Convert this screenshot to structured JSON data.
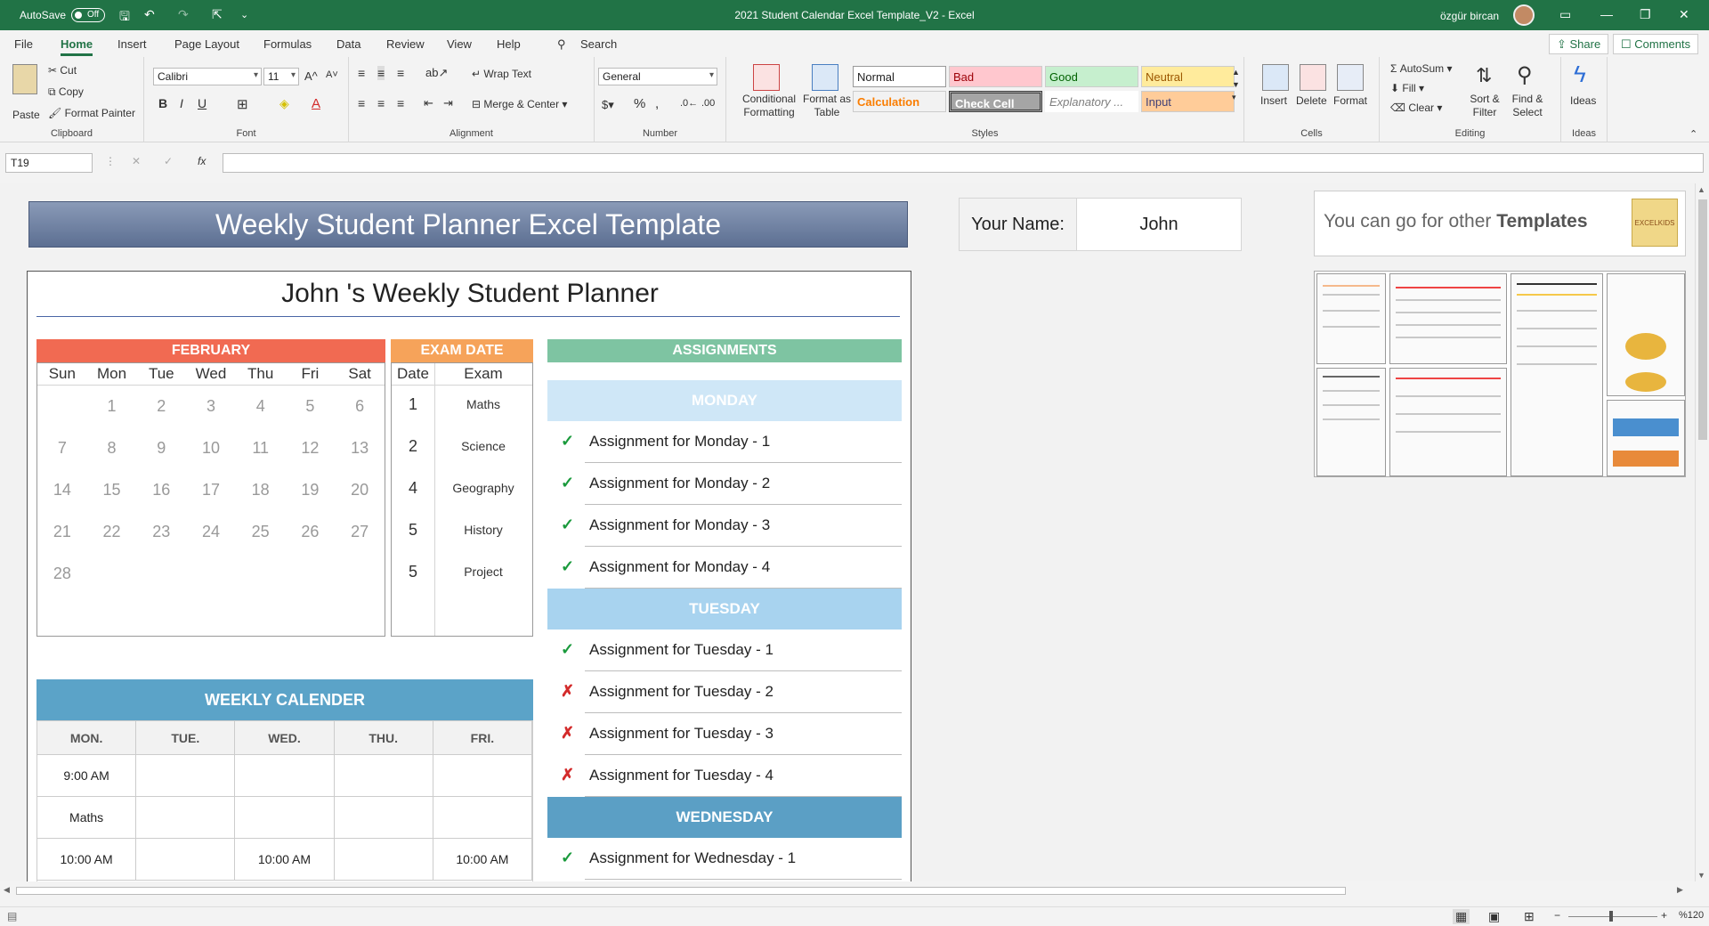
{
  "titlebar": {
    "autosave_label": "AutoSave",
    "autosave_state": "Off",
    "document_title": "2021 Student Calendar Excel Template_V2  -  Excel",
    "user_name": "özgür bircan"
  },
  "menu": {
    "tabs": [
      "File",
      "Home",
      "Insert",
      "Page Layout",
      "Formulas",
      "Data",
      "Review",
      "View",
      "Help"
    ],
    "search_label": "Search",
    "share_label": "Share",
    "comments_label": "Comments"
  },
  "ribbon": {
    "clipboard": {
      "paste": "Paste",
      "cut": "Cut",
      "copy": "Copy",
      "format_painter": "Format Painter",
      "label": "Clipboard"
    },
    "font": {
      "name": "Calibri",
      "size": "11",
      "label": "Font"
    },
    "alignment": {
      "wrap_text": "Wrap Text",
      "merge_center": "Merge & Center",
      "label": "Alignment"
    },
    "number": {
      "format": "General",
      "label": "Number"
    },
    "styles": {
      "conditional_formatting": "Conditional Formatting",
      "format_as_table": "Format as Table",
      "normal": "Normal",
      "bad": "Bad",
      "good": "Good",
      "neutral": "Neutral",
      "calculation": "Calculation",
      "check_cell": "Check Cell",
      "explanatory": "Explanatory ...",
      "input": "Input",
      "label": "Styles"
    },
    "cells": {
      "insert": "Insert",
      "delete": "Delete",
      "format": "Format",
      "label": "Cells"
    },
    "editing": {
      "autosum": "AutoSum",
      "fill": "Fill",
      "clear": "Clear",
      "sort_filter": "Sort & Filter",
      "find_select": "Find & Select",
      "label": "Editing"
    },
    "ideas": {
      "ideas": "Ideas",
      "label": "Ideas"
    }
  },
  "formula_bar": {
    "cell_ref": "T19",
    "fx": "fx",
    "formula": ""
  },
  "sheet": {
    "banner_title": "Weekly Student Planner Excel Template",
    "your_name_label": "Your Name:",
    "your_name_value": "John",
    "promo_text_plain": "You can go for other ",
    "promo_text_bold": "Templates",
    "promo_logo": "EXCELKIDS",
    "planner_title": "John 's Weekly Student Planner",
    "calendar": {
      "month": "FEBRUARY",
      "weekdays": [
        "Sun",
        "Mon",
        "Tue",
        "Wed",
        "Thu",
        "Fri",
        "Sat"
      ],
      "weeks": [
        [
          "",
          "1",
          "2",
          "3",
          "4",
          "5",
          "6"
        ],
        [
          "7",
          "8",
          "9",
          "10",
          "11",
          "12",
          "13"
        ],
        [
          "14",
          "15",
          "16",
          "17",
          "18",
          "19",
          "20"
        ],
        [
          "21",
          "22",
          "23",
          "24",
          "25",
          "26",
          "27"
        ],
        [
          "28",
          "",
          "",
          "",
          "",
          "",
          ""
        ]
      ]
    },
    "exams": {
      "header": "EXAM DATE",
      "col_date": "Date",
      "col_exam": "Exam",
      "rows": [
        {
          "date": "1",
          "exam": "Maths"
        },
        {
          "date": "2",
          "exam": "Science"
        },
        {
          "date": "4",
          "exam": "Geography"
        },
        {
          "date": "5",
          "exam": "History"
        },
        {
          "date": "5",
          "exam": "Project"
        }
      ]
    },
    "assignments": {
      "header": "ASSIGNMENTS",
      "days": [
        {
          "day": "MONDAY",
          "color": "#cfe7f7",
          "text_color": "#ffffff",
          "items": [
            {
              "done": true,
              "text": "Assignment for Monday - 1"
            },
            {
              "done": true,
              "text": "Assignment for Monday - 2"
            },
            {
              "done": true,
              "text": "Assignment for Monday - 3"
            },
            {
              "done": true,
              "text": "Assignment for Monday - 4"
            }
          ]
        },
        {
          "day": "TUESDAY",
          "color": "#a8d3ef",
          "text_color": "#ffffff",
          "items": [
            {
              "done": true,
              "text": "Assignment for Tuesday - 1"
            },
            {
              "done": false,
              "text": "Assignment for Tuesday - 2"
            },
            {
              "done": false,
              "text": "Assignment for Tuesday - 3"
            },
            {
              "done": false,
              "text": "Assignment for Tuesday - 4"
            }
          ]
        },
        {
          "day": "WEDNESDAY",
          "color": "#5b9fc5",
          "text_color": "#ffffff",
          "items": [
            {
              "done": true,
              "text": "Assignment for Wednesday - 1"
            }
          ]
        }
      ]
    },
    "weekly": {
      "header": "WEEKLY CALENDER",
      "days": [
        "MON.",
        "TUE.",
        "WED.",
        "THU.",
        "FRI."
      ],
      "rows": [
        [
          "9:00 AM",
          "",
          "",
          "",
          ""
        ],
        [
          "Maths",
          "",
          "",
          "",
          ""
        ],
        [
          "10:00 AM",
          "",
          "10:00 AM",
          "",
          "10:00 AM"
        ]
      ]
    }
  },
  "status": {
    "zoom": "%120"
  },
  "colors": {
    "excel_green": "#217346",
    "feb_header": "#f16a52",
    "exam_header": "#f6a35a",
    "assign_header": "#7ec4a2",
    "weekly_header": "#5ba3c8",
    "check": "#1a9a3c",
    "cross": "#d32b2b"
  }
}
